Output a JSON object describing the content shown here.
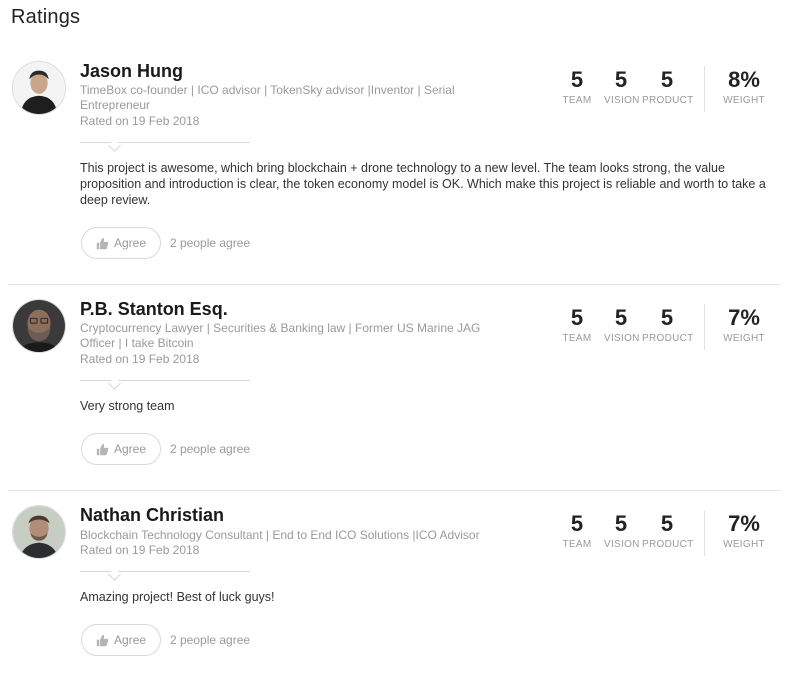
{
  "page": {
    "title": "Ratings"
  },
  "score_labels": {
    "team": "TEAM",
    "vision": "VISION",
    "product": "PRODUCT",
    "weight": "WEIGHT"
  },
  "agree_label": "Agree",
  "ratings": [
    {
      "name": "Jason Hung",
      "headline": "TimeBox co-founder | ICO advisor | TokenSky advisor |Inventor | Serial Entrepreneur",
      "rated_on": "Rated on 19 Feb 2018",
      "review": "This project is awesome, which bring blockchain + drone technology to a new level. The team looks strong, the value proposition and introduction is clear, the token economy model is OK. Which make this project is reliable and worth to take a deep review.",
      "team": "5",
      "vision": "5",
      "product": "5",
      "weight": "8%",
      "agree_count": "2 people agree"
    },
    {
      "name": "P.B. Stanton Esq.",
      "headline": "Cryptocurrency Lawyer | Securities & Banking law | Former US Marine JAG Officer | I take Bitcoin",
      "rated_on": "Rated on 19 Feb 2018",
      "review": "Very strong team",
      "team": "5",
      "vision": "5",
      "product": "5",
      "weight": "7%",
      "agree_count": "2 people agree"
    },
    {
      "name": "Nathan Christian",
      "headline": "Blockchain Technology Consultant | End to End ICO Solutions |ICO Advisor",
      "rated_on": "Rated on 19 Feb 2018",
      "review": "Amazing project! Best of luck guys!",
      "team": "5",
      "vision": "5",
      "product": "5",
      "weight": "7%",
      "agree_count": "2 people agree"
    }
  ]
}
